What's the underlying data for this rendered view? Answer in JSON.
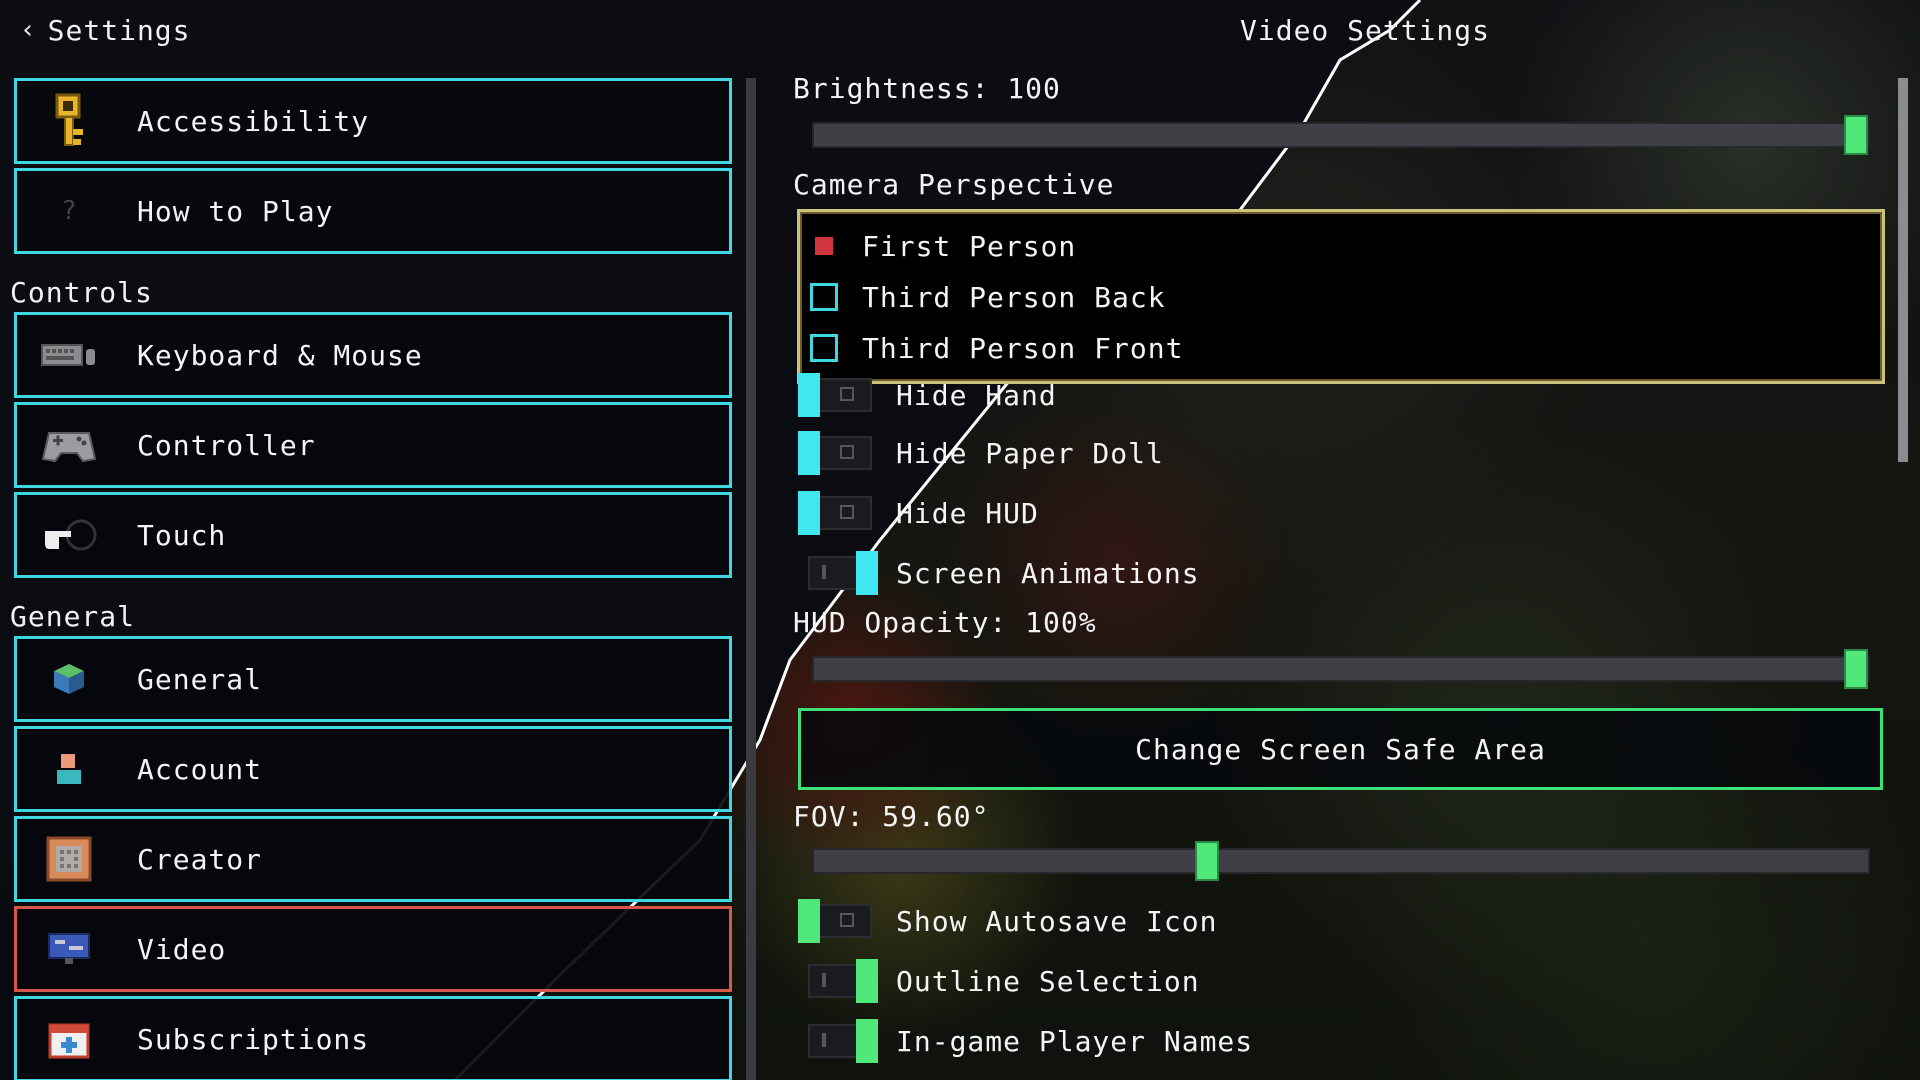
{
  "header": {
    "back_label": "Settings",
    "title": "Video Settings"
  },
  "sidebar": {
    "top_items": [
      {
        "label": "Accessibility",
        "icon": "key-icon"
      },
      {
        "label": "How to Play",
        "icon": "question-icon"
      }
    ],
    "controls_heading": "Controls",
    "controls_items": [
      {
        "label": "Keyboard & Mouse",
        "icon": "keyboard-icon"
      },
      {
        "label": "Controller",
        "icon": "gamepad-icon"
      },
      {
        "label": "Touch",
        "icon": "pointing-hand-icon"
      }
    ],
    "general_heading": "General",
    "general_items": [
      {
        "label": "General",
        "icon": "cube-icon"
      },
      {
        "label": "Account",
        "icon": "person-icon"
      },
      {
        "label": "Creator",
        "icon": "creator-icon"
      },
      {
        "label": "Video",
        "icon": "monitor-icon",
        "selected": true
      },
      {
        "label": "Subscriptions",
        "icon": "calendar-plus-icon"
      }
    ]
  },
  "video": {
    "brightness_label": "Brightness: 100",
    "brightness_value": 1.0,
    "camera_heading": "Camera Perspective",
    "camera_options": [
      {
        "label": "First Person",
        "checked": true
      },
      {
        "label": "Third Person Back",
        "checked": false
      },
      {
        "label": "Third Person Front",
        "checked": false
      }
    ],
    "toggles_a": [
      {
        "label": "Hide Hand",
        "on": true
      },
      {
        "label": "Hide Paper Doll",
        "on": true
      },
      {
        "label": "Hide HUD",
        "on": true
      },
      {
        "label": "Screen Animations",
        "on": false
      }
    ],
    "hud_opacity_label": "HUD Opacity: 100%",
    "hud_opacity_value": 1.0,
    "safe_area_button": "Change Screen Safe Area",
    "fov_label": "FOV: 59.60°",
    "fov_value": 0.37,
    "toggles_b": [
      {
        "label": "Show Autosave Icon",
        "on": true
      },
      {
        "label": "Outline Selection",
        "on": false
      },
      {
        "label": "In-game Player Names",
        "on": false
      }
    ]
  },
  "colors": {
    "border_cyan": "#3fd8e0",
    "border_selected": "#d6584c",
    "slider_green": "#50e87a",
    "toggle_cyan": "#3fe8ee",
    "radio_checked": "#d0343c"
  }
}
